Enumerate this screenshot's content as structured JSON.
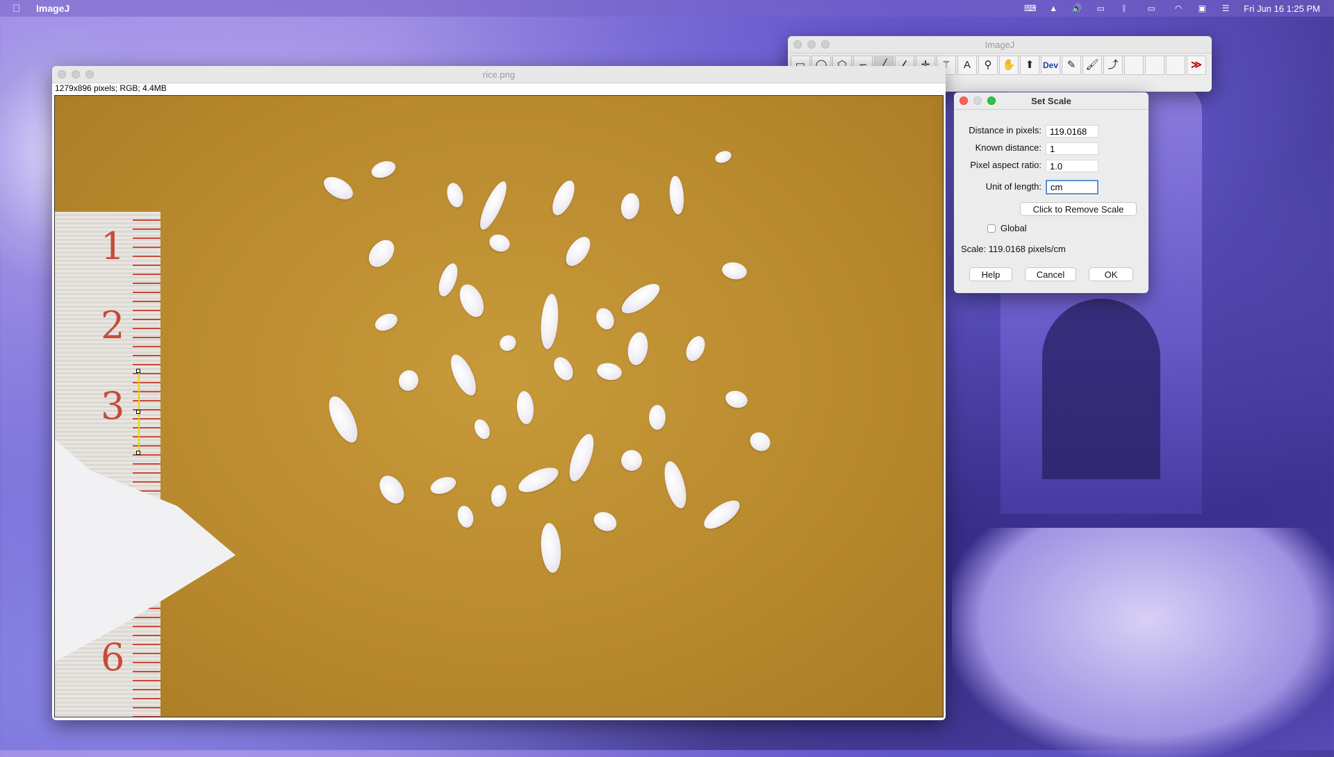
{
  "menubar": {
    "app_name": "ImageJ",
    "clock": "Fri Jun 16  1:25 PM",
    "status_icons": [
      "keyboard-icon",
      "vlc-icon",
      "volume-icon",
      "display-icon",
      "bluetooth-icon",
      "battery-icon",
      "wifi-icon",
      "display-mirror-icon",
      "control-center-icon"
    ]
  },
  "image_window": {
    "title": "rice.png",
    "info": "1279x896 pixels; RGB; 4.4MB",
    "ruler_numbers": [
      "1",
      "2",
      "3",
      "6"
    ]
  },
  "toolbar_window": {
    "title": "ImageJ",
    "tools": [
      "rectangle-tool",
      "oval-tool",
      "polygon-tool",
      "freehand-tool",
      "line-tool",
      "angle-tool",
      "point-tool",
      "wand-tool",
      "text-tool",
      "magnifier-tool",
      "hand-tool",
      "dropper-tool",
      "dev-menu",
      "pencil-tool",
      "brush-tool",
      "pipette-tool",
      "empty-slot",
      "empty-slot",
      "empty-slot",
      "more-tools"
    ],
    "dev_label": "Dev"
  },
  "dialog": {
    "title": "Set Scale",
    "distance_label": "Distance in pixels:",
    "distance_value": "119.0168",
    "known_label": "Known distance:",
    "known_value": "1",
    "aspect_label": "Pixel aspect ratio:",
    "aspect_value": "1.0",
    "unit_label": "Unit of length:",
    "unit_value": "cm",
    "remove_scale_label": "Click to Remove Scale",
    "global_label": "Global",
    "global_checked": false,
    "scale_text": "Scale: 119.0168 pixels/cm",
    "help_label": "Help",
    "cancel_label": "Cancel",
    "ok_label": "OK"
  }
}
